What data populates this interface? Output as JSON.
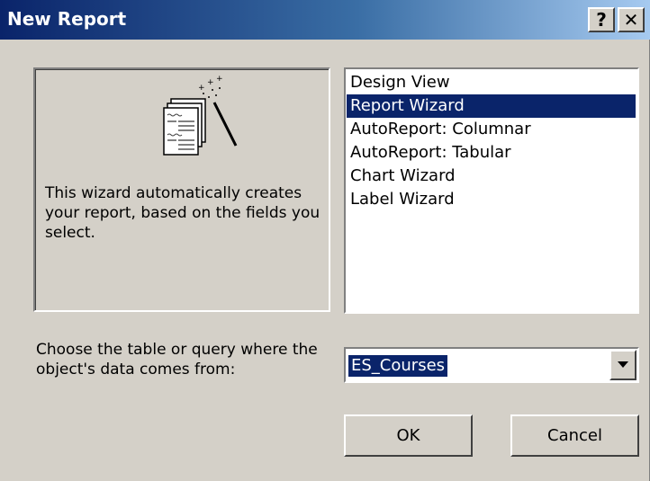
{
  "window": {
    "title": "New Report",
    "help_label": "?",
    "close_label": "✕"
  },
  "preview": {
    "description": "This wizard automatically creates your report, based on the fields you select."
  },
  "report_types": [
    {
      "label": "Design View",
      "selected": false
    },
    {
      "label": "Report Wizard",
      "selected": true
    },
    {
      "label": "AutoReport:  Columnar",
      "selected": false
    },
    {
      "label": "AutoReport:  Tabular",
      "selected": false
    },
    {
      "label": "Chart Wizard",
      "selected": false
    },
    {
      "label": "Label Wizard",
      "selected": false
    }
  ],
  "source": {
    "prompt": "Choose the table or query where the object's data comes from:",
    "selected_value": "ES_Courses"
  },
  "buttons": {
    "ok_label": "OK",
    "cancel_label": "Cancel"
  },
  "colors": {
    "face": "#d4d0c8",
    "selection": "#0a246a",
    "title_start": "#0a246a",
    "title_end": "#a6caf0"
  },
  "icons": {
    "preview_art": "report-wizard-icon",
    "combo_arrow": "chevron-down-icon"
  }
}
